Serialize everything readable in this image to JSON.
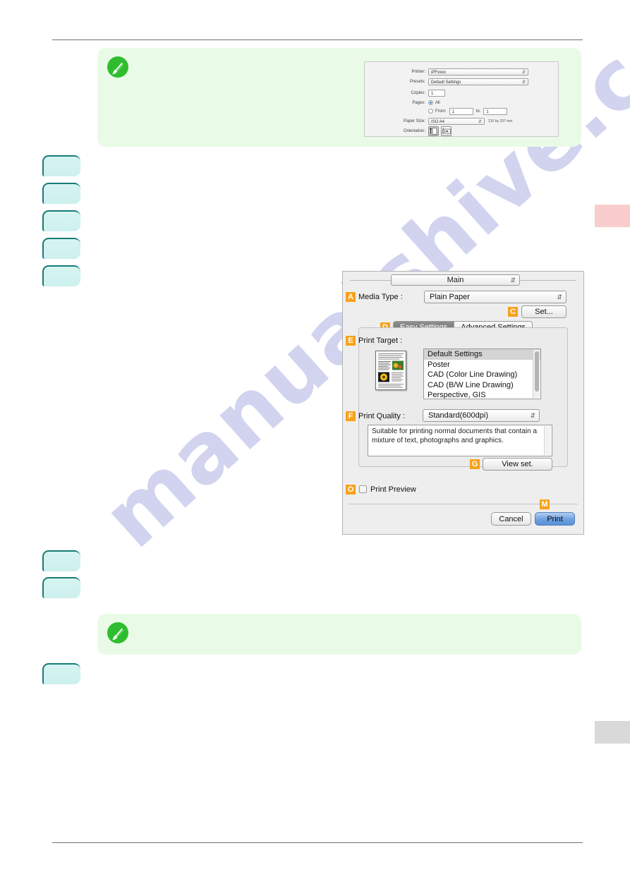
{
  "watermark": {
    "text": "manualshive.com"
  },
  "note_top": {
    "icon": "pencil-note-icon"
  },
  "note_bottom": {
    "icon": "pencil-note-icon"
  },
  "page_setup_dialog": {
    "rows": {
      "printer_label": "Printer:",
      "printer_value": "iPFxxxx",
      "presets_label": "Presets:",
      "presets_value": "Default Settings",
      "copies_label": "Copies:",
      "copies_value": "1",
      "pages_label": "Pages:",
      "pages_all": "All",
      "pages_from": "From:",
      "pages_from_value": "1",
      "pages_to": "to:",
      "pages_to_value": "1",
      "paper_size_label": "Paper Size:",
      "paper_size_value": "ISO A4",
      "paper_size_note": "210 by 297 mm",
      "orientation_label": "Orientation:"
    }
  },
  "print_dialog": {
    "pane_select": "Main",
    "badges": {
      "a": "A",
      "c": "C",
      "d": "D",
      "e": "E",
      "f": "F",
      "g": "G",
      "o": "O",
      "m": "M"
    },
    "media_type_label": "Media Type :",
    "media_type_value": "Plain Paper",
    "set_button": "Set...",
    "tabs": [
      {
        "label": "Easy Settings",
        "active": true
      },
      {
        "label": "Advanced Settings",
        "active": false
      }
    ],
    "print_target_label": "Print Target :",
    "print_target_items": [
      "Default Settings",
      "Poster",
      "CAD (Color Line Drawing)",
      "CAD (B/W Line Drawing)",
      "Perspective, GIS"
    ],
    "print_target_selected": "Default Settings",
    "print_quality_label": "Print Quality :",
    "print_quality_value": "Standard(600dpi)",
    "description": "Suitable for printing normal documents that contain a mixture of text, photographs and graphics.",
    "view_set_button": "View set.",
    "print_preview_label": "Print Preview",
    "cancel_button": "Cancel",
    "print_button": "Print"
  },
  "colors": {
    "badge_orange": "#f7a21a",
    "note_green": "#e9fbe6",
    "note_icon_green": "#2fbd2f",
    "step_box_teal": "#cdf0ee",
    "step_box_border": "#177a77",
    "edge_pink": "#f9cdcd",
    "edge_gray": "#d9d9d9",
    "watermark": "#c9cced",
    "primary_button_blue": "#5b92d9"
  }
}
